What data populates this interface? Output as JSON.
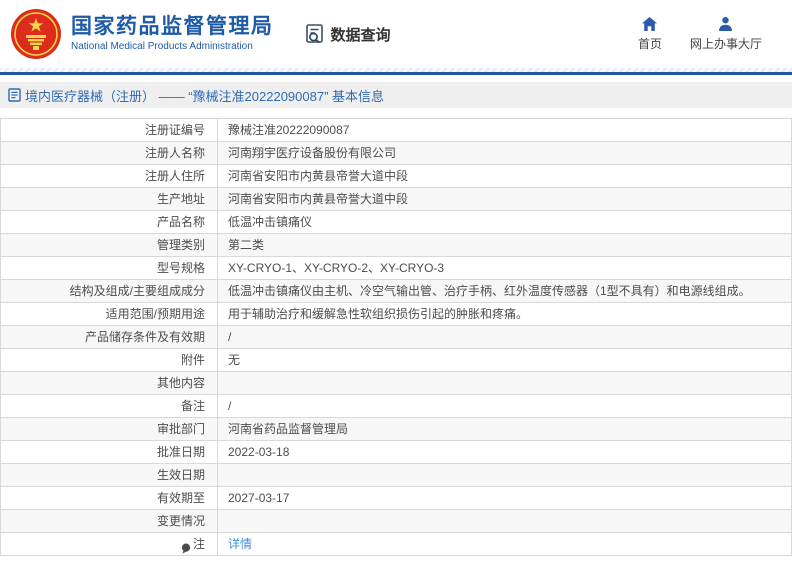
{
  "header": {
    "org_name_cn": "国家药品监督管理局",
    "org_name_en": "National Medical Products Administration",
    "data_query_label": "数据查询",
    "nav": [
      {
        "icon": "home-icon",
        "label": "首页"
      },
      {
        "icon": "person-icon",
        "label": "网上办事大厅"
      }
    ]
  },
  "breadcrumb": {
    "text": "境内医疗器械（注册） —— “豫械注准20222090087” 基本信息"
  },
  "table": {
    "rows": [
      {
        "label": "注册证编号",
        "value": "豫械注准20222090087"
      },
      {
        "label": "注册人名称",
        "value": "河南翔宇医疗设备股份有限公司"
      },
      {
        "label": "注册人住所",
        "value": "河南省安阳市内黄县帝誉大道中段"
      },
      {
        "label": "生产地址",
        "value": "河南省安阳市内黄县帝誉大道中段"
      },
      {
        "label": "产品名称",
        "value": "低温冲击镇痛仪"
      },
      {
        "label": "管理类别",
        "value": "第二类"
      },
      {
        "label": "型号规格",
        "value": "XY-CRYO-1、XY-CRYO-2、XY-CRYO-3"
      },
      {
        "label": "结构及组成/主要组成成分",
        "value": "低温冲击镇痛仪由主机、冷空气输出管、治疗手柄、红外温度传感器（1型不具有）和电源线组成。"
      },
      {
        "label": "适用范围/预期用途",
        "value": "用于辅助治疗和缓解急性软组织损伤引起的肿胀和疼痛。"
      },
      {
        "label": "产品储存条件及有效期",
        "value": "/"
      },
      {
        "label": "附件",
        "value": "无"
      },
      {
        "label": "其他内容",
        "value": ""
      },
      {
        "label": "备注",
        "value": "/"
      },
      {
        "label": "审批部门",
        "value": "河南省药品监督管理局"
      },
      {
        "label": "批准日期",
        "value": "2022-03-18"
      },
      {
        "label": "生效日期",
        "value": ""
      },
      {
        "label": "有效期至",
        "value": "2027-03-17"
      },
      {
        "label": "变更情况",
        "value": ""
      },
      {
        "label": "注",
        "value": "详情",
        "value_is_link": true,
        "label_icon": "note-icon"
      }
    ]
  },
  "colors": {
    "brand_blue": "#1e5ba7",
    "stripe_blue": "#2456a4",
    "breadcrumb_bg": "#efeff0",
    "breadcrumb_text": "#2f6bb3",
    "row_alt_bg": "#f7f7f7",
    "table_border": "#d9d9d9",
    "link_blue": "#4090d8",
    "emblem_red": "#dd2b1c",
    "emblem_gold": "#f7d648"
  }
}
